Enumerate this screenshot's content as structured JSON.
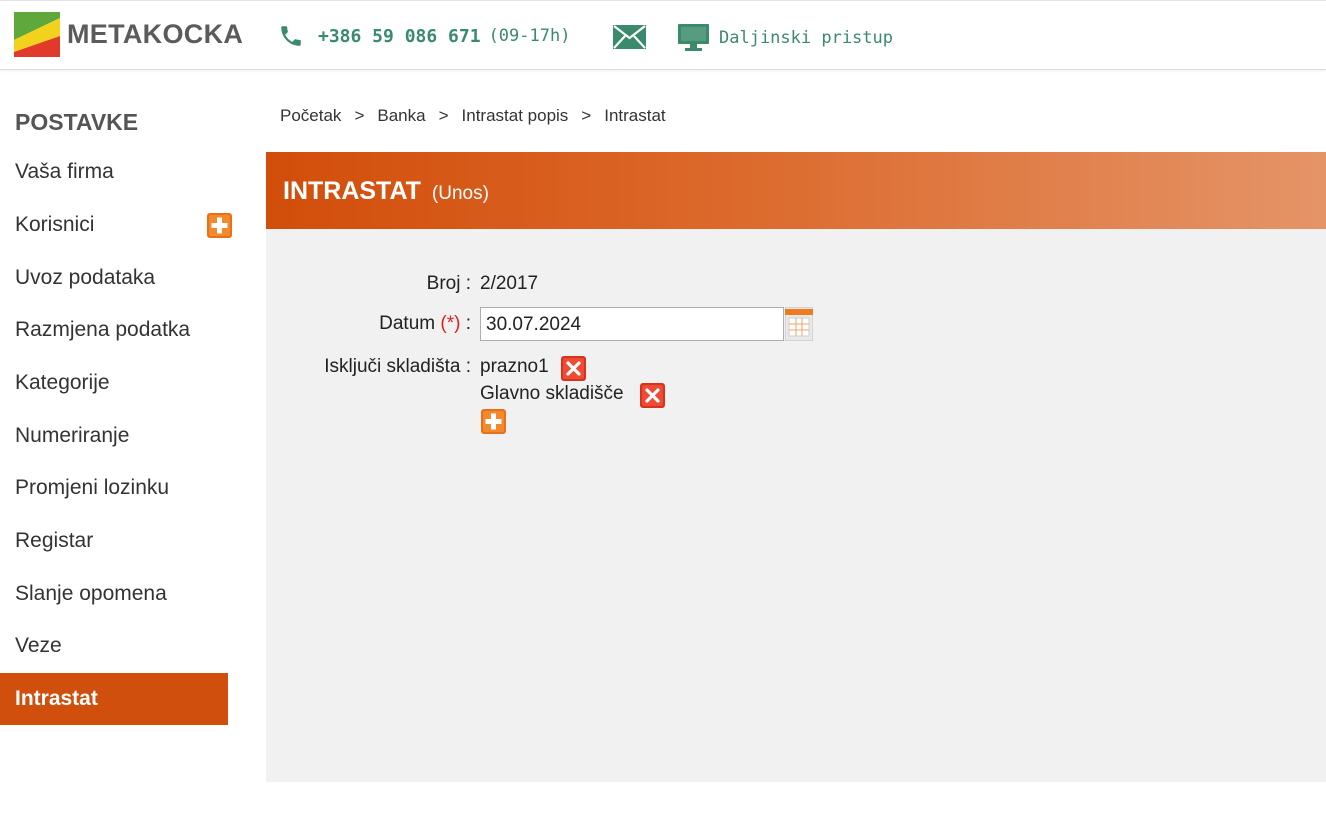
{
  "header": {
    "logo_text": "METAKOCKA",
    "phone_number": "+386 59 086 671",
    "phone_hours": "(09-17h)",
    "mail_icon": "envelope-icon",
    "remote_label": "Daljinski pristup",
    "accent_color": "#3a8a6c"
  },
  "sidebar": {
    "title": "POSTAVKE",
    "items": [
      {
        "label": "Vaša firma"
      },
      {
        "label": "Korisnici",
        "icon": "plus-icon"
      },
      {
        "label": "Uvoz podataka"
      },
      {
        "label": "Razmjena podatka"
      },
      {
        "label": "Kategorije"
      },
      {
        "label": "Numeriranje"
      },
      {
        "label": "Promjeni lozinku"
      },
      {
        "label": "Registar"
      },
      {
        "label": "Slanje opomena"
      },
      {
        "label": "Veze"
      },
      {
        "label": "Intrastat",
        "active": true
      }
    ],
    "active_color": "#d04f0c"
  },
  "breadcrumb": {
    "items": [
      "Početak",
      "Banka",
      "Intrastat popis",
      "Intrastat"
    ],
    "separator": ">"
  },
  "main": {
    "title": "INTRASTAT",
    "subtitle": "(Unos)",
    "form": {
      "broj_label": "Broj :",
      "broj_value": "2/2017",
      "datum_label": "Datum",
      "datum_required": "(*)",
      "datum_colon": ":",
      "datum_value": "30.07.2024",
      "iskljuci_label": "Isključi skladišta :",
      "warehouses": [
        "prazno1",
        "Glavno skladišče"
      ]
    }
  }
}
